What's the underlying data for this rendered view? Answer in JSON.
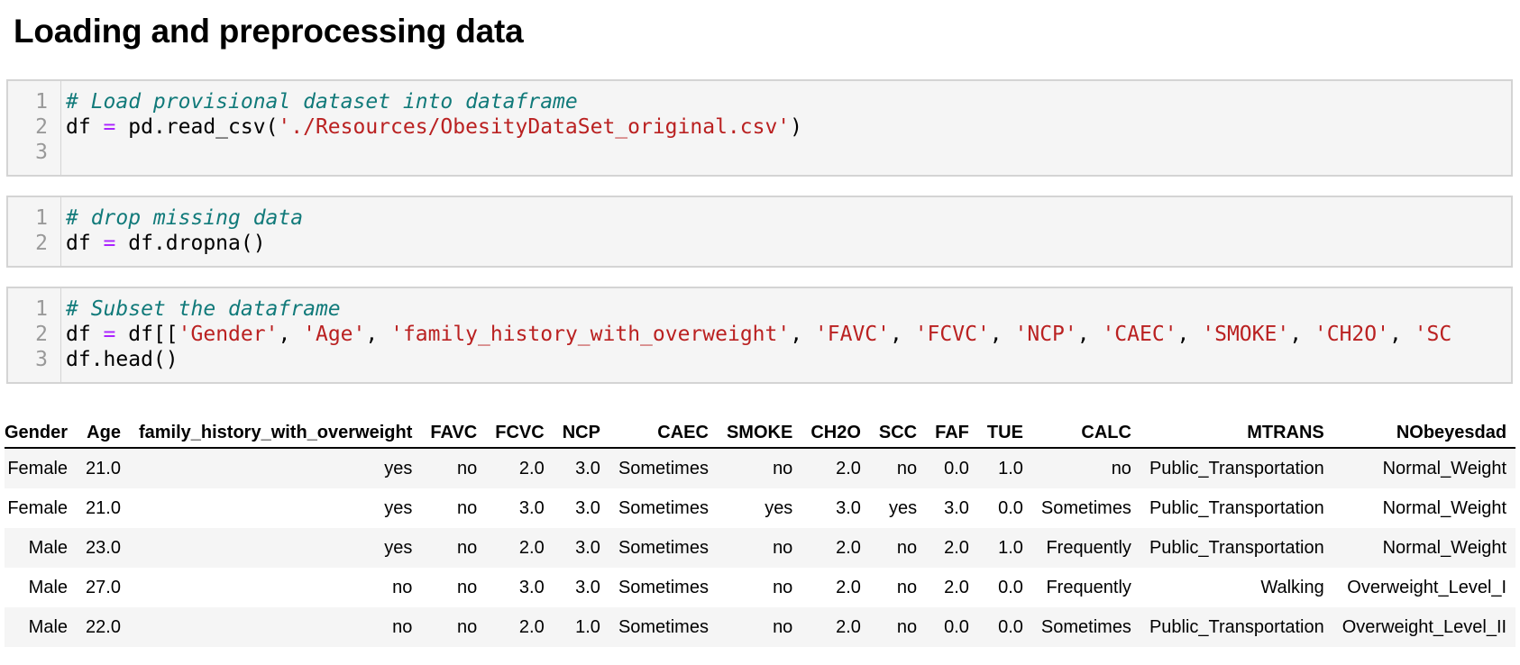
{
  "heading": "Loading and preprocessing data",
  "cells": [
    {
      "line_numbers": [
        "1",
        "2",
        "3"
      ],
      "lines": [
        [
          {
            "t": "# Load provisional dataset into dataframe",
            "c": "cm"
          }
        ],
        [
          {
            "t": "df ",
            "c": ""
          },
          {
            "t": "=",
            "c": "op"
          },
          {
            "t": " pd.read_csv(",
            "c": ""
          },
          {
            "t": "'./Resources/ObesityDataSet_original.csv'",
            "c": "st"
          },
          {
            "t": ")",
            "c": ""
          }
        ],
        []
      ]
    },
    {
      "line_numbers": [
        "1",
        "2"
      ],
      "lines": [
        [
          {
            "t": "# drop missing data",
            "c": "cm"
          }
        ],
        [
          {
            "t": "df ",
            "c": ""
          },
          {
            "t": "=",
            "c": "op"
          },
          {
            "t": " df.dropna()",
            "c": ""
          }
        ]
      ]
    },
    {
      "line_numbers": [
        "1",
        "2",
        "3"
      ],
      "lines": [
        [
          {
            "t": "# Subset the dataframe",
            "c": "cm"
          }
        ],
        [
          {
            "t": "df ",
            "c": ""
          },
          {
            "t": "=",
            "c": "op"
          },
          {
            "t": " df[[",
            "c": ""
          },
          {
            "t": "'Gender'",
            "c": "st"
          },
          {
            "t": ", ",
            "c": ""
          },
          {
            "t": "'Age'",
            "c": "st"
          },
          {
            "t": ", ",
            "c": ""
          },
          {
            "t": "'family_history_with_overweight'",
            "c": "st"
          },
          {
            "t": ", ",
            "c": ""
          },
          {
            "t": "'FAVC'",
            "c": "st"
          },
          {
            "t": ", ",
            "c": ""
          },
          {
            "t": "'FCVC'",
            "c": "st"
          },
          {
            "t": ", ",
            "c": ""
          },
          {
            "t": "'NCP'",
            "c": "st"
          },
          {
            "t": ", ",
            "c": ""
          },
          {
            "t": "'CAEC'",
            "c": "st"
          },
          {
            "t": ", ",
            "c": ""
          },
          {
            "t": "'SMOKE'",
            "c": "st"
          },
          {
            "t": ", ",
            "c": ""
          },
          {
            "t": "'CH2O'",
            "c": "st"
          },
          {
            "t": ", ",
            "c": ""
          },
          {
            "t": "'SC",
            "c": "st"
          }
        ],
        [
          {
            "t": "df.head()",
            "c": ""
          }
        ]
      ]
    }
  ],
  "table": {
    "columns": [
      "Gender",
      "Age",
      "family_history_with_overweight",
      "FAVC",
      "FCVC",
      "NCP",
      "CAEC",
      "SMOKE",
      "CH2O",
      "SCC",
      "FAF",
      "TUE",
      "CALC",
      "MTRANS",
      "NObeyesdad"
    ],
    "rows": [
      [
        "Female",
        "21.0",
        "yes",
        "no",
        "2.0",
        "3.0",
        "Sometimes",
        "no",
        "2.0",
        "no",
        "0.0",
        "1.0",
        "no",
        "Public_Transportation",
        "Normal_Weight"
      ],
      [
        "Female",
        "21.0",
        "yes",
        "no",
        "3.0",
        "3.0",
        "Sometimes",
        "yes",
        "3.0",
        "yes",
        "3.0",
        "0.0",
        "Sometimes",
        "Public_Transportation",
        "Normal_Weight"
      ],
      [
        "Male",
        "23.0",
        "yes",
        "no",
        "2.0",
        "3.0",
        "Sometimes",
        "no",
        "2.0",
        "no",
        "2.0",
        "1.0",
        "Frequently",
        "Public_Transportation",
        "Normal_Weight"
      ],
      [
        "Male",
        "27.0",
        "no",
        "no",
        "3.0",
        "3.0",
        "Sometimes",
        "no",
        "2.0",
        "no",
        "2.0",
        "0.0",
        "Frequently",
        "Walking",
        "Overweight_Level_I"
      ],
      [
        "Male",
        "22.0",
        "no",
        "no",
        "2.0",
        "1.0",
        "Sometimes",
        "no",
        "2.0",
        "no",
        "0.0",
        "0.0",
        "Sometimes",
        "Public_Transportation",
        "Overweight_Level_II"
      ]
    ]
  }
}
